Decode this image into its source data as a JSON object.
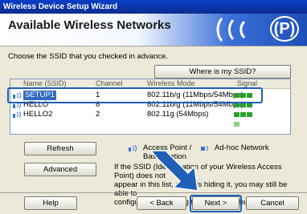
{
  "window": {
    "title": "Wireless Device Setup Wizard"
  },
  "banner": {
    "title": "Available Wireless Networks",
    "logo": "(P)"
  },
  "instruction": "Choose the SSID that you checked in advance.",
  "where_button": "Where is my SSID?",
  "list": {
    "headers": [
      "Name (SSID)",
      "Channel",
      "Wireless Mode",
      "Signal"
    ],
    "rows": [
      {
        "icon": "access-point-icon",
        "ssid": "SETUP1",
        "channel": "1",
        "mode": "802.11b/g (11Mbps/54Mbps)",
        "signal": 4,
        "selected": true
      },
      {
        "icon": "access-point-icon",
        "ssid": "HELLO",
        "channel": "6",
        "mode": "802.11b/g (11Mbps/54Mbps)",
        "signal": 3,
        "selected": false
      },
      {
        "icon": "access-point-icon",
        "ssid": "HELLO2",
        "channel": "2",
        "mode": "802.11g (54Mbps)",
        "signal": 3,
        "selected": false
      }
    ]
  },
  "refresh_button": "Refresh",
  "advanced_button": "Advanced",
  "legend": {
    "ap_label": "Access Point /",
    "ap_label2": "Base Station",
    "adhoc_label": "Ad-hoc Network"
  },
  "note_lines": [
    "If the SSID (Identification of your Wireless Access Point) does not",
    "appear in this list, or if it is hiding it, you may still be able to",
    "configure it by clicking the Advanced button."
  ],
  "footer": {
    "help": "Help",
    "back": "< Back",
    "next": "Next >",
    "cancel": "Cancel"
  },
  "colors": {
    "accent": "#1f5fb8",
    "signal": "#2aa02a",
    "title_bar": "#0a3ec8"
  }
}
